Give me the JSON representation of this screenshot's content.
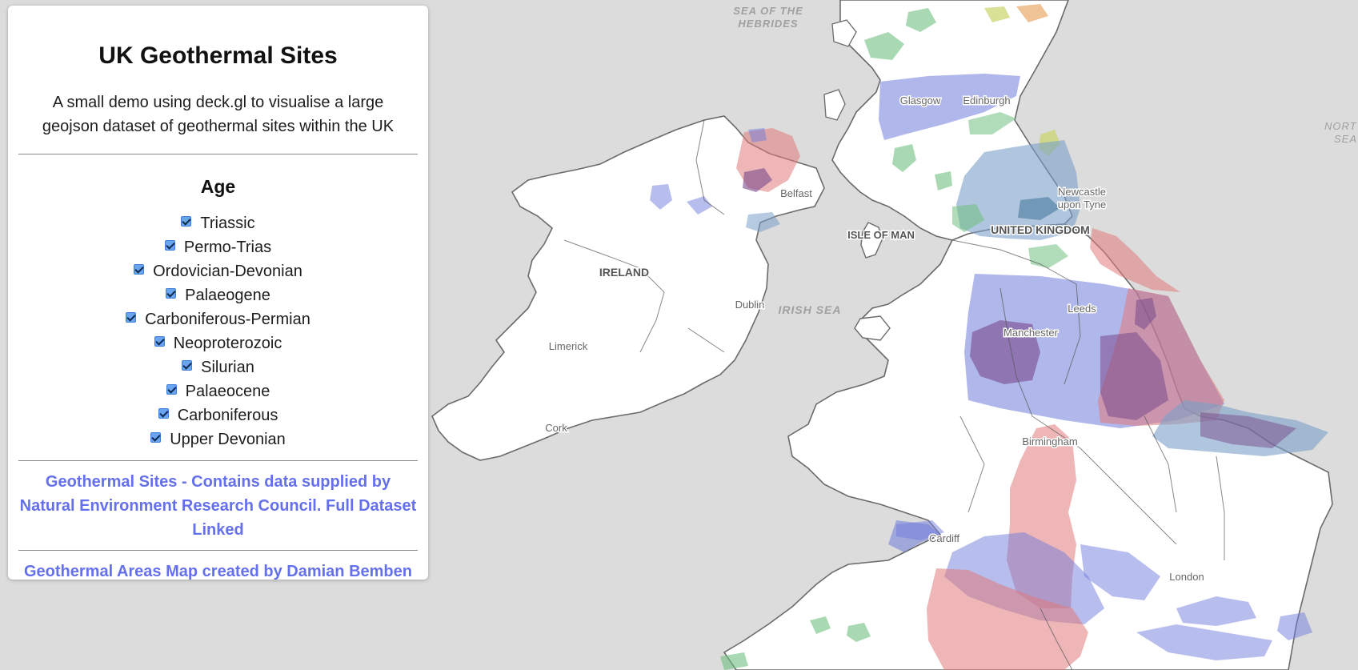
{
  "panel": {
    "title": "UK Geothermal Sites",
    "description": "A small demo using deck.gl to visualise a large geojson dataset of geothermal sites within the UK",
    "age_heading": "Age",
    "ages": [
      {
        "label": "Triassic",
        "checked": true
      },
      {
        "label": "Permo-Trias",
        "checked": true
      },
      {
        "label": "Ordovician-Devonian",
        "checked": true
      },
      {
        "label": "Palaeogene",
        "checked": true
      },
      {
        "label": "Carboniferous-Permian",
        "checked": true
      },
      {
        "label": "Neoproterozoic",
        "checked": true
      },
      {
        "label": "Silurian",
        "checked": true
      },
      {
        "label": "Palaeocene",
        "checked": true
      },
      {
        "label": "Carboniferous",
        "checked": true
      },
      {
        "label": "Upper Devonian",
        "checked": true
      }
    ],
    "credit_dataset": "Geothermal Sites - Contains data supplied by Natural Environment Research Council. Full Dataset Linked",
    "credit_author": "Geothermal Areas Map created by Damian Bemben"
  },
  "map": {
    "sea_labels": {
      "hebrides_line1": "SEA OF THE",
      "hebrides_line2": "HEBRIDES",
      "irish_sea": "IRISH SEA",
      "north_sea_line1": "NORT",
      "north_sea_line2": "SEA"
    },
    "country_labels": {
      "ireland": "IRELAND",
      "united_kingdom": "UNITED KINGDOM",
      "isle_of_man": "ISLE OF MAN"
    },
    "cities": {
      "glasgow": "Glasgow",
      "edinburgh": "Edinburgh",
      "belfast": "Belfast",
      "newcastle_line1": "Newcastle",
      "newcastle_line2": "upon Tyne",
      "dublin": "Dublin",
      "leeds": "Leeds",
      "manchester": "Manchester",
      "limerick": "Limerick",
      "cork": "Cork",
      "birmingham": "Birmingham",
      "cardiff": "Cardiff",
      "london": "London"
    },
    "colors": {
      "water": "#dcdcdc",
      "land": "#ffffff",
      "pink_area": "#e07a7a",
      "blue_area": "#6f7bdb",
      "green_area": "#6fbf7f",
      "yellow_area": "#c9d46a",
      "orange_area": "#e8a96a",
      "steel_area": "#7aa0c8",
      "purple_area": "#7a4a8c"
    }
  }
}
